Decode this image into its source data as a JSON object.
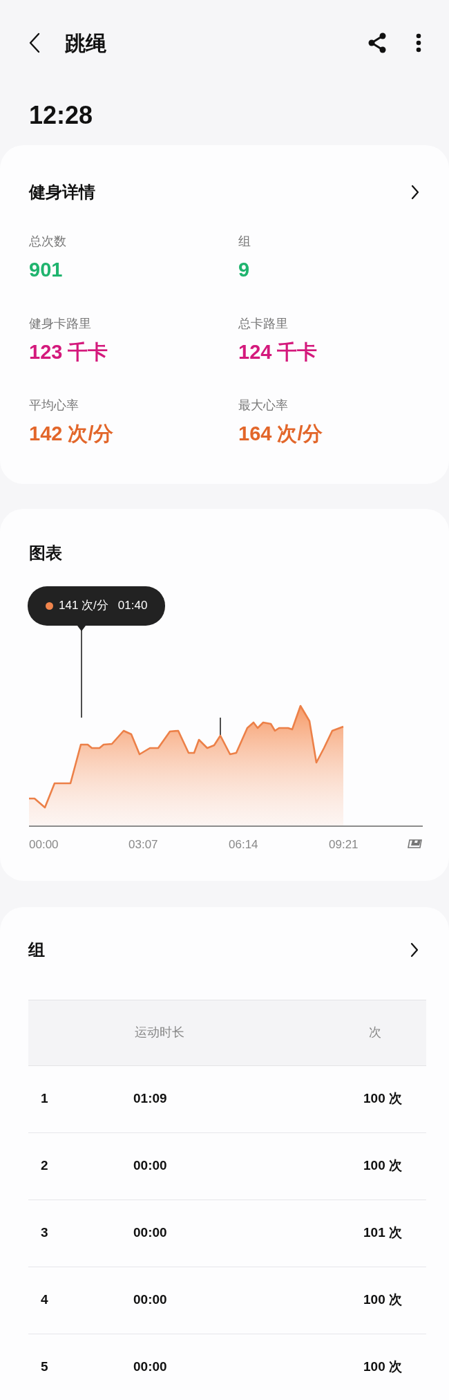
{
  "header": {
    "title": "跳绳"
  },
  "time": "12:28",
  "details": {
    "title": "健身详情",
    "stats": [
      {
        "label": "总次数",
        "value": "901",
        "color": "#1fb46e"
      },
      {
        "label": "组",
        "value": "9",
        "color": "#1fb46e"
      },
      {
        "label": "健身卡路里",
        "value": "123 千卡",
        "color": "#d4197c"
      },
      {
        "label": "总卡路里",
        "value": "124 千卡",
        "color": "#d4197c"
      },
      {
        "label": "平均心率",
        "value": "142 次/分",
        "color": "#e2662a"
      },
      {
        "label": "最大心率",
        "value": "164 次/分",
        "color": "#e2662a"
      }
    ]
  },
  "chart": {
    "title": "图表",
    "tooltip": {
      "value": "141 次/分",
      "time": "01:40",
      "color": "#f0844c"
    },
    "x_labels": [
      "00:00",
      "03:07",
      "06:14",
      "09:21"
    ]
  },
  "sets": {
    "title": "组",
    "columns": [
      "运动时长",
      "次"
    ],
    "rows": [
      {
        "index": "1",
        "duration": "01:09",
        "count": "100 次"
      },
      {
        "index": "2",
        "duration": "00:00",
        "count": "100 次"
      },
      {
        "index": "3",
        "duration": "00:00",
        "count": "101 次"
      },
      {
        "index": "4",
        "duration": "00:00",
        "count": "100 次"
      },
      {
        "index": "5",
        "duration": "00:00",
        "count": "100 次"
      }
    ]
  }
}
